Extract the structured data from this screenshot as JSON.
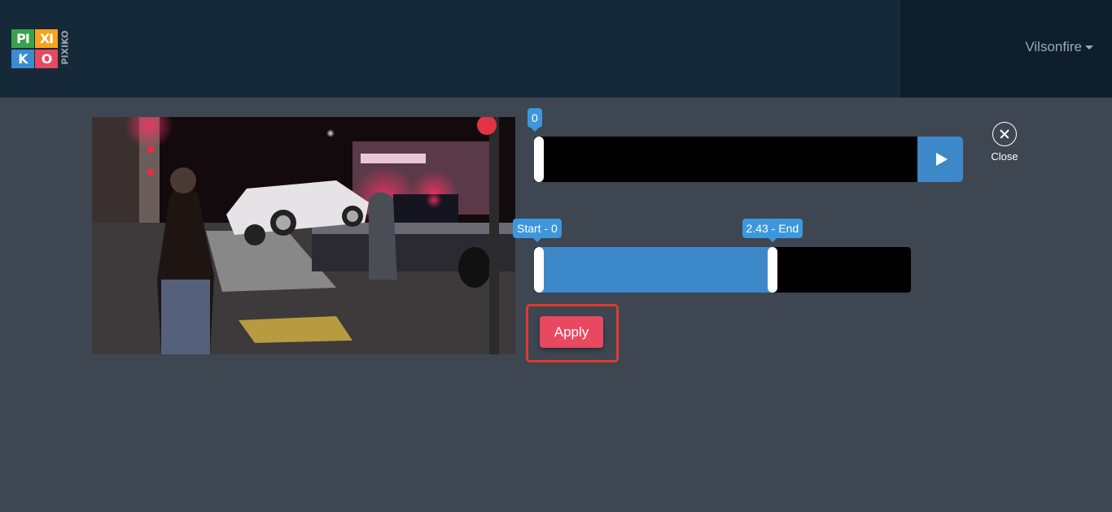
{
  "header": {
    "logo": {
      "tiles": [
        "PI",
        "XI",
        "K",
        "O"
      ],
      "side_text": "PIXIKO",
      "colors": [
        "#3aa14b",
        "#f4a51c",
        "#3b8bd0",
        "#e84860"
      ]
    },
    "user_menu": {
      "label": "Vilsonfire",
      "icon": "caret-down-icon"
    }
  },
  "video": {
    "description": "night street scene: white SUV lifted onto tow truck, police lights, pedestrian in foreground"
  },
  "preview_slider": {
    "current_label": "0",
    "position_fraction": 0.0,
    "play_icon": "play-icon"
  },
  "close": {
    "label": "Close",
    "icon": "close-circle-icon"
  },
  "trim_slider": {
    "start_label": "Start - 0",
    "end_label": "2.43 - End",
    "start_value": 0,
    "end_value": 2.43,
    "selected_fraction_end": 0.62
  },
  "apply": {
    "label": "Apply"
  },
  "colors": {
    "accent_blue": "#3d88c8",
    "tooltip_blue": "#3d97dc",
    "apply_red": "#e84860",
    "highlight_red": "#e0392f"
  }
}
